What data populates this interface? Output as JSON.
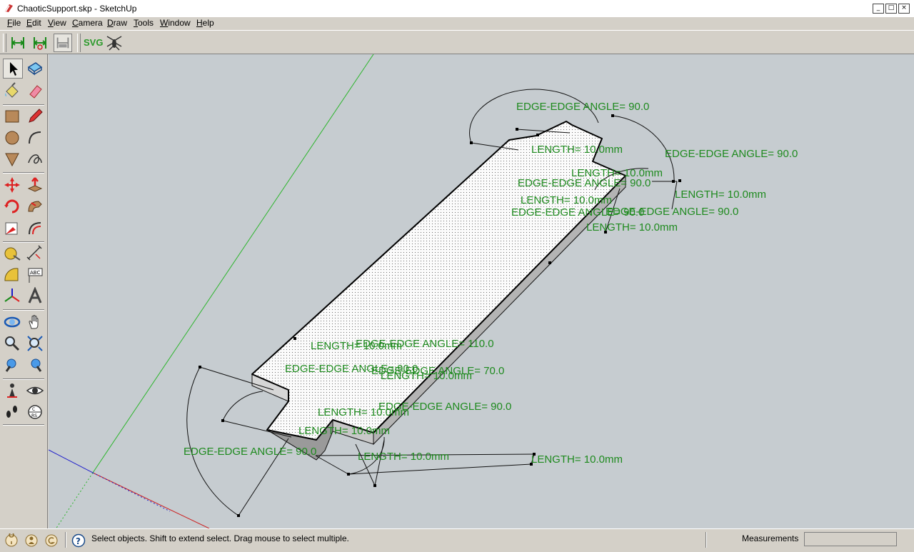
{
  "window": {
    "title": "ChaoticSupport.skp - SketchUp",
    "controls": [
      "minimize",
      "maximize",
      "close"
    ]
  },
  "menu": [
    "File",
    "Edit",
    "View",
    "Camera",
    "Draw",
    "Tools",
    "Window",
    "Help"
  ],
  "toolbar": {
    "svg_label": "SVG",
    "icons": [
      "dimension-icon",
      "dimension-radius-icon",
      "dimension-disabled-icon",
      "svg-export-icon",
      "bug-icon"
    ]
  },
  "tools": [
    "select",
    "make-component",
    "paint-bucket",
    "eraser",
    "rectangle",
    "line",
    "circle",
    "arc",
    "polygon",
    "freehand",
    "move",
    "push-pull",
    "rotate",
    "follow-me",
    "scale",
    "offset",
    "tape-measure",
    "dimension",
    "protractor",
    "text",
    "axes",
    "3d-text",
    "orbit",
    "pan",
    "zoom",
    "zoom-extents",
    "previous-view",
    "next-view",
    "position-camera",
    "look-around",
    "walk",
    "section-plane"
  ],
  "annotations": {
    "a1": "EDGE-EDGE ANGLE= 90.0",
    "a2": "LENGTH= 10.0mm",
    "a3": "EDGE-EDGE ANGLE= 90.0",
    "a4": "LENGTH= 10.0mm",
    "a5": "EDGE-EDGE ANGLE= 90.0",
    "a6": "LENGTH= 10.0mm",
    "a7": "LENGTH= 10.0mm",
    "a8": "EDGE-EDGE ANGLE= 90.0",
    "a9": "EDGE-EDGE ANGLE= 90.0",
    "a10": "LENGTH= 10.0mm",
    "a11": "EDGE-EDGE ANGLE= 110.0",
    "a12": "LENGTH= 10.0mm",
    "a13": "EDGE-EDGE ANGLE= 90.0",
    "a14": "EDGE-EDGE ANGLE= 70.0",
    "a15": "LENGTH= 10.0mm",
    "a16": "EDGE-EDGE ANGLE= 90.0",
    "a17": "LENGTH= 10.0mm",
    "a18": "LENGTH= 10.0mm",
    "a19": "EDGE-EDGE ANGLE= 90.0",
    "a20": "LENGTH= 10.0mm",
    "a21": "LENGTH= 10.0mm"
  },
  "status": {
    "hint": "Select objects. Shift to extend select. Drag mouse to select multiple.",
    "measurements_label": "Measurements",
    "measurements_value": ""
  },
  "colors": {
    "viewport_bg": "#c6ccd0",
    "dimension_text": "#1e8a1e",
    "green_axis": "#2bb52b",
    "red_axis": "#cc2222",
    "blue_axis": "#2222cc"
  }
}
